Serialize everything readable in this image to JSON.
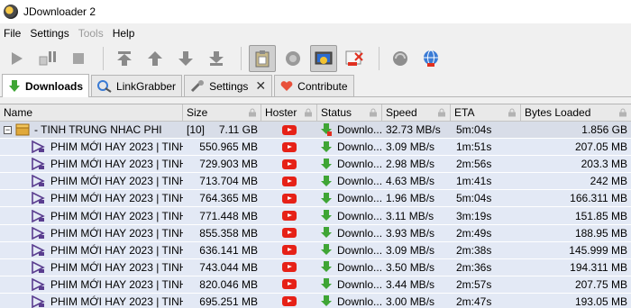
{
  "window": {
    "title": "JDownloader 2"
  },
  "menu": [
    {
      "label": "File",
      "disabled": false
    },
    {
      "label": "Settings",
      "disabled": false
    },
    {
      "label": "Tools",
      "disabled": true
    },
    {
      "label": "Help",
      "disabled": false
    }
  ],
  "tabs": [
    {
      "label": "Downloads",
      "icon": "download-arrow-icon",
      "active": true
    },
    {
      "label": "LinkGrabber",
      "icon": "linkgrabber-icon",
      "active": false
    },
    {
      "label": "Settings",
      "icon": "wrench-icon",
      "active": false,
      "closable": true
    },
    {
      "label": "Contribute",
      "icon": "heart-icon",
      "active": false
    }
  ],
  "columns": {
    "name": "Name",
    "size": "Size",
    "hoster": "Hoster",
    "status": "Status",
    "speed": "Speed",
    "eta": "ETA",
    "bytes": "Bytes Loaded"
  },
  "package": {
    "name": "- TINH TRUNG NHAC PHI",
    "count": "[10]",
    "size": "7.11 GB",
    "status": "Downlo...",
    "speed": "32.73 MB/s",
    "eta": "5m:04s",
    "bytes": "1.856 GB"
  },
  "rows": [
    {
      "name": "PHIM MỚI HAY 2023 | TINH T...",
      "size": "550.965 MB",
      "status": "Downlo...",
      "speed": "3.09 MB/s",
      "eta": "1m:51s",
      "bytes": "207.05 MB"
    },
    {
      "name": "PHIM MỚI HAY 2023 | TINH T...",
      "size": "729.903 MB",
      "status": "Downlo...",
      "speed": "2.98 MB/s",
      "eta": "2m:56s",
      "bytes": "203.3 MB"
    },
    {
      "name": "PHIM MỚI HAY 2023 | TINH T...",
      "size": "713.704 MB",
      "status": "Downlo...",
      "speed": "4.63 MB/s",
      "eta": "1m:41s",
      "bytes": "242 MB"
    },
    {
      "name": "PHIM MỚI HAY 2023 | TINH T...",
      "size": "764.365 MB",
      "status": "Downlo...",
      "speed": "1.96 MB/s",
      "eta": "5m:04s",
      "bytes": "166.311 MB"
    },
    {
      "name": "PHIM MỚI HAY 2023 | TINH T...",
      "size": "771.448 MB",
      "status": "Downlo...",
      "speed": "3.11 MB/s",
      "eta": "3m:19s",
      "bytes": "151.85 MB"
    },
    {
      "name": "PHIM MỚI HAY 2023 | TINH T...",
      "size": "855.358 MB",
      "status": "Downlo...",
      "speed": "3.93 MB/s",
      "eta": "2m:49s",
      "bytes": "188.95 MB"
    },
    {
      "name": "PHIM MỚI HAY 2023 | TINH T...",
      "size": "636.141 MB",
      "status": "Downlo...",
      "speed": "3.09 MB/s",
      "eta": "2m:38s",
      "bytes": "145.999 MB"
    },
    {
      "name": "PHIM MỚI HAY 2023 | TINH T...",
      "size": "743.044 MB",
      "status": "Downlo...",
      "speed": "3.50 MB/s",
      "eta": "2m:36s",
      "bytes": "194.311 MB"
    },
    {
      "name": "PHIM MỚI HAY 2023 | TINH T...",
      "size": "820.046 MB",
      "status": "Downlo...",
      "speed": "3.44 MB/s",
      "eta": "2m:57s",
      "bytes": "207.75 MB"
    },
    {
      "name": "PHIM MỚI HAY 2023 | TINH T...",
      "size": "695.251 MB",
      "status": "Downlo...",
      "speed": "3.00 MB/s",
      "eta": "2m:47s",
      "bytes": "193.05 MB"
    }
  ],
  "colors": {
    "row_child": "#e3e9f5",
    "row_package": "#d8dde8",
    "download_green": "#3fa535",
    "youtube_red": "#e62117"
  }
}
